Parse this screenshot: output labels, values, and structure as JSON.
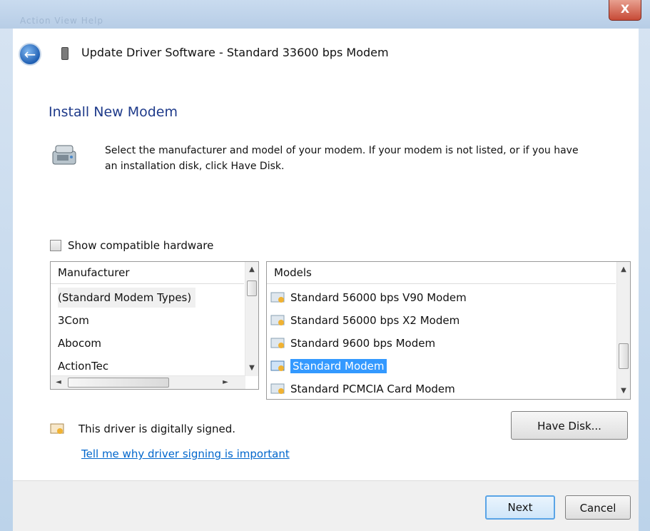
{
  "window": {
    "close_glyph": "X",
    "blurred_menu": "Action   View   Help"
  },
  "header": {
    "title": "Update Driver Software - Standard 33600 bps Modem"
  },
  "main": {
    "section_title": "Install New Modem",
    "description": "Select the manufacturer and model of your modem. If your modem is not listed, or if you have an installation disk, click Have Disk.",
    "show_compatible": {
      "label": "Show compatible hardware",
      "checked": false
    },
    "manufacturer_list": {
      "header": "Manufacturer",
      "items": [
        "(Standard Modem Types)",
        "3Com",
        "Abocom",
        "ActionTec"
      ],
      "selected_index": 0
    },
    "models_list": {
      "header": "Models",
      "items": [
        "Standard 56000 bps V90 Modem",
        "Standard 56000 bps X2 Modem",
        "Standard 9600 bps Modem",
        "Standard Modem",
        "Standard PCMCIA Card Modem"
      ],
      "selected_index": 3
    },
    "signed_text": "This driver is digitally signed.",
    "signing_link": "Tell me why driver signing is important",
    "have_disk_label": "Have Disk..."
  },
  "footer": {
    "next_label": "Next",
    "cancel_label": "Cancel"
  },
  "colors": {
    "accent": "#3399ff",
    "title_blue": "#1e3a8a",
    "link": "#0066cc"
  },
  "icons": [
    "back-arrow-icon",
    "window-icon",
    "modem-icon",
    "certificate-icon",
    "close-icon"
  ]
}
